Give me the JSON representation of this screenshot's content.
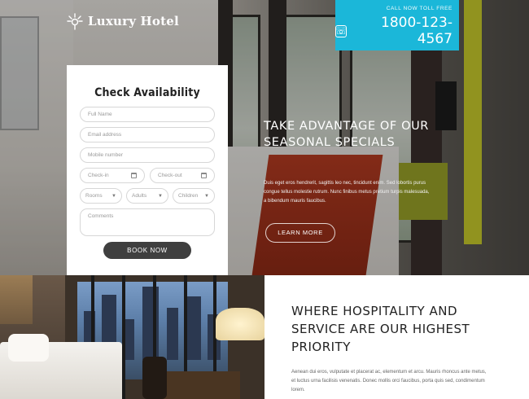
{
  "brand": {
    "name": "Luxury Hotel",
    "icon": "sparkle-logo-icon"
  },
  "phone_banner": {
    "label": "CALL NOW TOLL FREE",
    "number": "1800-123-4567",
    "icon": "phone-icon"
  },
  "form": {
    "title": "Check Availability",
    "fields": {
      "full_name": "Full Name",
      "email": "Email address",
      "mobile": "Mobile number",
      "check_in": "Check-in",
      "check_out": "Check-out",
      "rooms": "Rooms",
      "adults": "Adults",
      "children": "Children",
      "comments": "Comments"
    },
    "submit_label": "BOOK NOW"
  },
  "hero": {
    "heading_line1": "TAKE ADVANTAGE OF OUR",
    "heading_line2": "SEASONAL SPECIALS",
    "body": "Duis eget eros hendrerit, sagittis leo nec, tincidunt enim. Sed lobortis purus congue tellus molestie rutrum. Nunc finibus metus pretium turpis malesuada, a bibendum mauris faucibus.",
    "cta_label": "LEARN MORE"
  },
  "section2": {
    "heading_line1": "WHERE HOSPITALITY AND",
    "heading_line2": "SERVICE ARE OUR HIGHEST",
    "heading_line3": "PRIORITY",
    "body": "Aenean dui eros, vulputate et placerat ac, elementum et arcu. Mauris rhoncus ante metus, et luctus urna facilisis venenatis. Donec mollis orci faucibus, porta quis sed, condimentum lorem."
  },
  "colors": {
    "accent": "#1bb7d9",
    "button_dark": "#3f3f3f"
  }
}
